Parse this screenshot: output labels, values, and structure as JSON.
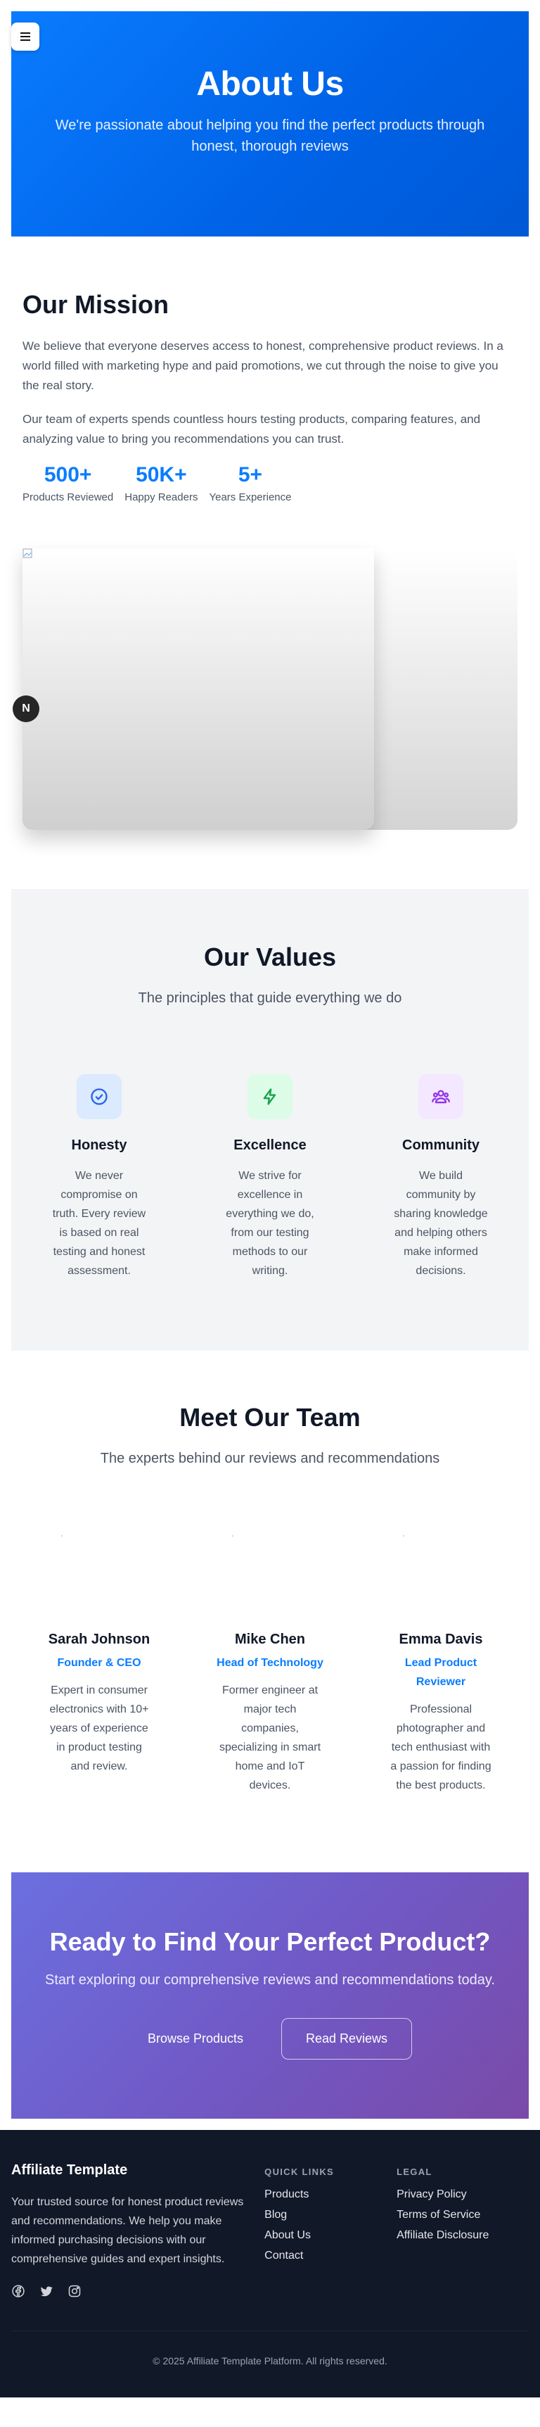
{
  "hero": {
    "title": "About Us",
    "subtitle": "We're passionate about helping you find the perfect products through honest, thorough reviews"
  },
  "mission": {
    "title": "Our Mission",
    "paragraph_1": "We believe that everyone deserves access to honest, comprehensive product reviews. In a world filled with marketing hype and paid promotions, we cut through the noise to give you the real story.",
    "paragraph_2": "Our team of experts spends countless hours testing products, comparing features, and analyzing value to bring you recommendations you can trust.",
    "stats": [
      {
        "value": "500+",
        "label": "Products Reviewed"
      },
      {
        "value": "50K+",
        "label": "Happy Readers"
      },
      {
        "value": "5+",
        "label": "Years Experience"
      }
    ]
  },
  "badge": {
    "letter": "N"
  },
  "values": {
    "title": "Our Values",
    "subtitle": "The principles that guide everything we do",
    "items": [
      {
        "title": "Honesty",
        "text": "We never compromise on truth. Every review is based on real testing and honest assessment.",
        "icon": "check-circle-icon",
        "color": "#2563eb",
        "bg": "#dbeafe"
      },
      {
        "title": "Excellence",
        "text": "We strive for excellence in everything we do, from our testing methods to our writing.",
        "icon": "lightning-icon",
        "color": "#16a34a",
        "bg": "#dcfce7"
      },
      {
        "title": "Community",
        "text": "We build community by sharing knowledge and helping others make informed decisions.",
        "icon": "users-icon",
        "color": "#9333ea",
        "bg": "#f3e8ff"
      }
    ]
  },
  "team": {
    "title": "Meet Our Team",
    "subtitle": "The experts behind our reviews and recommendations",
    "members": [
      {
        "name": "Sarah Johnson",
        "role": "Founder & CEO",
        "bio": "Expert in consumer electronics with 10+ years of experience in product testing and review."
      },
      {
        "name": "Mike Chen",
        "role": "Head of Technology",
        "bio": "Former engineer at major tech companies, specializing in smart home and IoT devices."
      },
      {
        "name": "Emma Davis",
        "role": "Lead Product Reviewer",
        "bio": "Professional photographer and tech enthusiast with a passion for finding the best products."
      }
    ]
  },
  "cta": {
    "title": "Ready to Find Your Perfect Product?",
    "subtitle": "Start exploring our comprehensive reviews and recommendations today.",
    "browse_label": "Browse Products",
    "reviews_label": "Read Reviews"
  },
  "footer": {
    "brand": "Affiliate Template",
    "description": "Your trusted source for honest product reviews and recommendations. We help you make informed purchasing decisions with our comprehensive guides and expert insights.",
    "quick_links_title": "QUICK LINKS",
    "quick_links": [
      "Products",
      "Blog",
      "About Us",
      "Contact"
    ],
    "legal_title": "LEGAL",
    "legal_links": [
      "Privacy Policy",
      "Terms of Service",
      "Affiliate Disclosure"
    ],
    "copyright": "© 2025 Affiliate Template Platform. All rights reserved."
  }
}
